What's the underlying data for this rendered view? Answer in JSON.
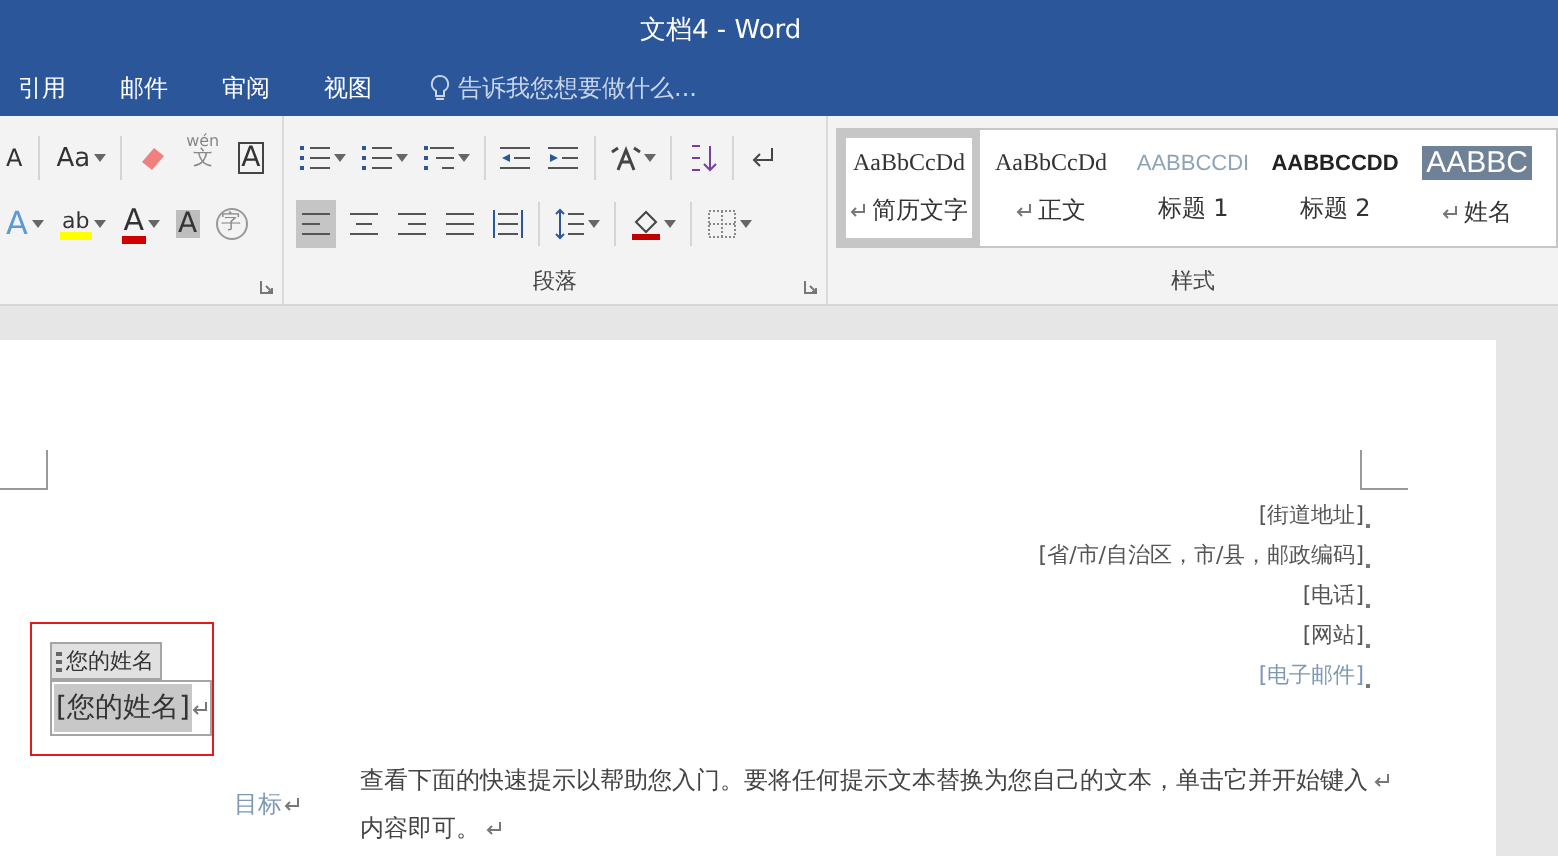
{
  "window": {
    "title": "文档4 - Word"
  },
  "tabs": [
    {
      "label": "引用",
      "selected": false
    },
    {
      "label": "邮件",
      "selected": false
    },
    {
      "label": "审阅",
      "selected": false
    },
    {
      "label": "视图",
      "selected": false
    }
  ],
  "tell_me": {
    "placeholder": "告诉我您想要做什么..."
  },
  "font_group": {
    "row_1": [
      {
        "kind": "grow",
        "label": "A"
      },
      {
        "kind": "case",
        "label": "Aa"
      },
      {
        "kind": "eraser"
      },
      {
        "kind": "phonetic",
        "label": "wén",
        "sub": "文"
      },
      {
        "kind": "boxed",
        "label": "A"
      }
    ],
    "row_2": [
      {
        "kind": "effects",
        "label": "A"
      },
      {
        "kind": "highlight",
        "label": "ab"
      },
      {
        "kind": "fontcolor",
        "label": "A"
      },
      {
        "kind": "shaded",
        "label": "A"
      },
      {
        "kind": "circled",
        "label": "字"
      }
    ]
  },
  "paragraph_group": {
    "label": "段落",
    "row_1": [
      {
        "kind": "bullets",
        "dropdown": true
      },
      {
        "kind": "numbering",
        "dropdown": true
      },
      {
        "kind": "multilevel",
        "dropdown": true
      },
      {
        "kind": "outdent",
        "dropdown": false
      },
      {
        "kind": "indent",
        "dropdown": false
      },
      {
        "kind": "asian",
        "dropdown": true
      },
      {
        "kind": "sort",
        "dropdown": false
      },
      {
        "kind": "marks",
        "dropdown": false
      }
    ],
    "alignment": [
      {
        "kind": "left",
        "selected": true
      },
      {
        "kind": "center",
        "selected": false
      },
      {
        "kind": "right",
        "selected": false
      },
      {
        "kind": "justify",
        "selected": false
      },
      {
        "kind": "distribute",
        "selected": false
      }
    ],
    "row_2_tools": [
      {
        "kind": "spacing",
        "dropdown": true
      },
      {
        "kind": "shading",
        "dropdown": true
      },
      {
        "kind": "borders",
        "dropdown": true
      }
    ]
  },
  "styles_group": {
    "label": "样式",
    "items": [
      {
        "kind": "serif_small",
        "preview": "AaBbCcDd",
        "name": "简历文字",
        "mark": true,
        "selected": true
      },
      {
        "kind": "serif",
        "preview": "AaBbCcDd",
        "name": "正文",
        "mark": true,
        "selected": false
      },
      {
        "kind": "light_caps",
        "preview": "AABBCCDI",
        "name": "标题 1",
        "mark": false,
        "selected": false
      },
      {
        "kind": "bold_caps",
        "preview": "AABBCCDD",
        "name": "标题 2",
        "mark": false,
        "selected": false
      },
      {
        "kind": "banner",
        "preview": "AABBC",
        "name": "姓名",
        "mark": true,
        "selected": false
      }
    ]
  },
  "document": {
    "address_lines": [
      {
        "text": "[街道地址]",
        "kind": "plain"
      },
      {
        "text": "[省/市/自治区，市/县，邮政编码]",
        "kind": "plain"
      },
      {
        "text": "[电话]",
        "kind": "plain"
      },
      {
        "text": "[网站]",
        "kind": "plain"
      },
      {
        "text": "[电子邮件]",
        "kind": "link"
      }
    ],
    "name_control": {
      "tag": "您的姓名",
      "value": "[您的姓名]"
    },
    "objective": {
      "heading": "目标",
      "lines": [
        "查看下面的快速提示以帮助您入门。要将任何提示文本替换为您自己的文本，单击它并开始键入",
        "内容即可。"
      ]
    }
  }
}
